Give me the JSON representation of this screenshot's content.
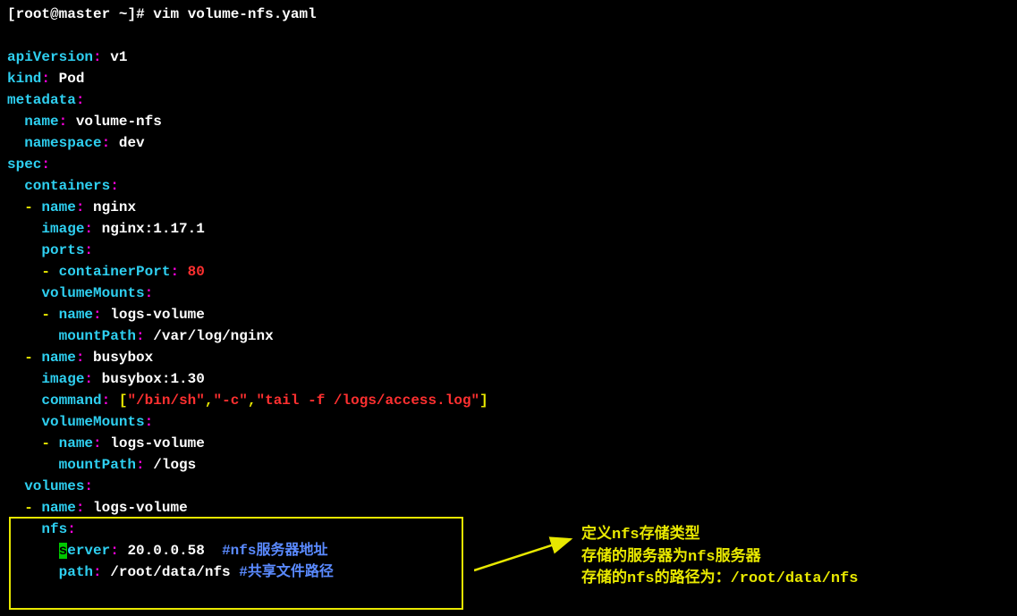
{
  "prompt": {
    "user": "root",
    "host": "master",
    "dir": "~",
    "symbol": "#",
    "command": "vim volume-nfs.yaml"
  },
  "yaml": {
    "apiVersion": {
      "key": "apiVersion",
      "value": "v1"
    },
    "kind": {
      "key": "kind",
      "value": "Pod"
    },
    "metadata": {
      "key": "metadata",
      "name": {
        "key": "name",
        "value": "volume-nfs"
      },
      "namespace": {
        "key": "namespace",
        "value": "dev"
      }
    },
    "spec": {
      "key": "spec",
      "containers": {
        "key": "containers"
      },
      "c1": {
        "name": {
          "key": "name",
          "value": "nginx"
        },
        "image": {
          "key": "image",
          "value": "nginx:1.17.1"
        },
        "ports": {
          "key": "ports"
        },
        "containerPort": {
          "key": "containerPort",
          "value": "80"
        },
        "volumeMounts": {
          "key": "volumeMounts"
        },
        "mount": {
          "name": {
            "key": "name",
            "value": "logs-volume"
          },
          "mountPath": {
            "key": "mountPath",
            "value": "/var/log/nginx"
          }
        }
      },
      "c2": {
        "name": {
          "key": "name",
          "value": "busybox"
        },
        "image": {
          "key": "image",
          "value": "busybox:1.30"
        },
        "command": {
          "key": "command",
          "bracket_open": "[",
          "bracket_close": "]",
          "q1": "\"/bin/sh\"",
          "q2": "\"-c\"",
          "q3": "\"tail -f /logs/access.log\""
        },
        "volumeMounts": {
          "key": "volumeMounts"
        },
        "mount": {
          "name": {
            "key": "name",
            "value": "logs-volume"
          },
          "mountPath": {
            "key": "mountPath",
            "value": "/logs"
          }
        }
      },
      "volumes": {
        "key": "volumes"
      },
      "vol": {
        "name": {
          "key": "name",
          "value": "logs-volume"
        },
        "nfs": {
          "key": "nfs"
        },
        "server": {
          "first_char": "s",
          "rest": "erver",
          "value": "20.0.0.58",
          "comment": "#nfs服务器地址"
        },
        "path": {
          "key": "path",
          "value": "/root/data/nfs",
          "comment": "#共享文件路径"
        }
      }
    }
  },
  "annotations": {
    "line1": "定义nfs存储类型",
    "line2": "存储的服务器为nfs服务器",
    "line3": "存储的nfs的路径为：/root/data/nfs"
  }
}
